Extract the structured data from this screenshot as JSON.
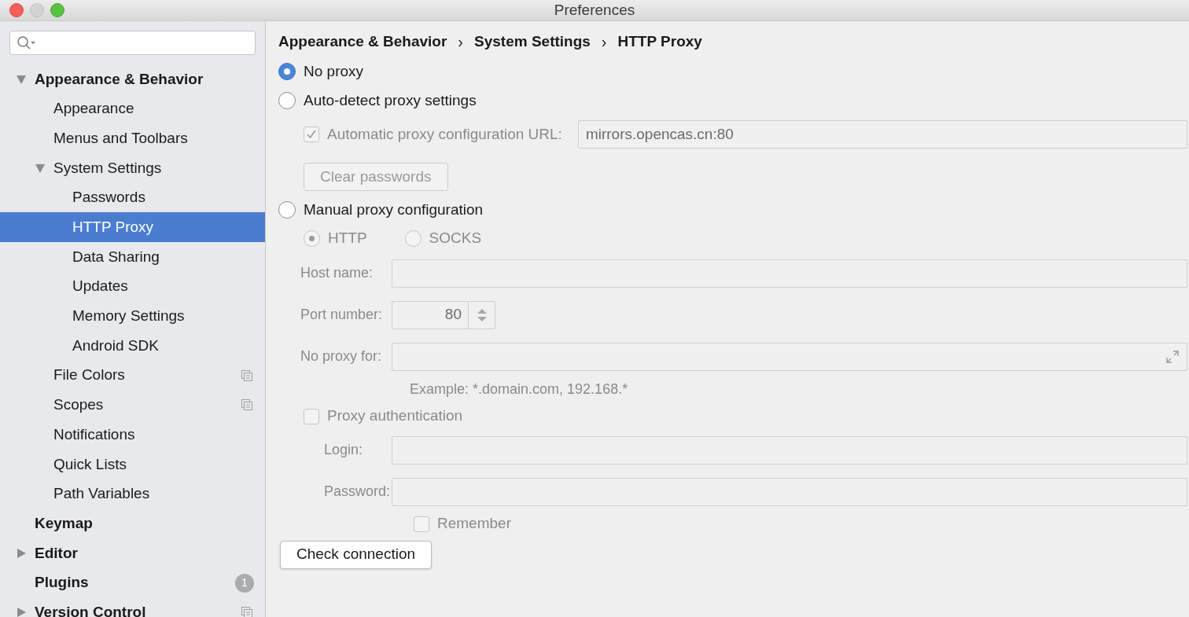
{
  "window": {
    "title": "Preferences"
  },
  "sidebar": {
    "items": [
      {
        "label": "Appearance & Behavior",
        "bold": true,
        "selected": false,
        "expanded": true,
        "children": [
          {
            "label": "Appearance",
            "selected": false
          },
          {
            "label": "Menus and Toolbars",
            "selected": false
          },
          {
            "label": "System Settings",
            "selected": false,
            "expanded": true,
            "children": [
              {
                "label": "Passwords",
                "selected": false
              },
              {
                "label": "HTTP Proxy",
                "selected": true
              },
              {
                "label": "Data Sharing",
                "selected": false
              },
              {
                "label": "Updates",
                "selected": false
              },
              {
                "label": "Memory Settings",
                "selected": false
              },
              {
                "label": "Android SDK",
                "selected": false
              }
            ]
          },
          {
            "label": "File Colors",
            "selected": false,
            "project_icon": true
          },
          {
            "label": "Scopes",
            "selected": false,
            "project_icon": true
          },
          {
            "label": "Notifications",
            "selected": false
          },
          {
            "label": "Quick Lists",
            "selected": false
          },
          {
            "label": "Path Variables",
            "selected": false
          }
        ]
      },
      {
        "label": "Keymap",
        "bold": true,
        "selected": false
      },
      {
        "label": "Editor",
        "bold": true,
        "selected": false,
        "expanded": false
      },
      {
        "label": "Plugins",
        "bold": true,
        "selected": false,
        "badge": "1"
      },
      {
        "label": "Version Control",
        "bold": true,
        "selected": false,
        "expanded": false,
        "project_icon": true
      }
    ]
  },
  "breadcrumb": {
    "separator": "›",
    "items": [
      "Appearance & Behavior",
      "System Settings",
      "HTTP Proxy"
    ]
  },
  "proxy_modes": [
    {
      "label": "No proxy",
      "selected": true
    },
    {
      "label": "Auto-detect proxy settings",
      "selected": false
    },
    {
      "label": "Manual proxy configuration",
      "selected": false
    }
  ],
  "auto_detect": {
    "disabled": true,
    "pac_checkbox": {
      "label": "Automatic proxy configuration URL:",
      "checked": true
    },
    "pac_url": "mirrors.opencas.cn:80",
    "clear_passwords_button": "Clear passwords"
  },
  "manual": {
    "disabled": true,
    "protocols": [
      {
        "label": "HTTP",
        "selected": true
      },
      {
        "label": "SOCKS",
        "selected": false
      }
    ],
    "host_label": "Host name:",
    "port_label": "Port number:",
    "port_value": "80",
    "no_proxy_label": "No proxy for:",
    "example": "Example: *.domain.com, 192.168.*",
    "auth_checkbox": {
      "label": "Proxy authentication",
      "checked": false
    },
    "login_label": "Login:",
    "password_label": "Password:",
    "remember": {
      "label": "Remember",
      "checked": false
    }
  },
  "check_connection_button": "Check connection"
}
